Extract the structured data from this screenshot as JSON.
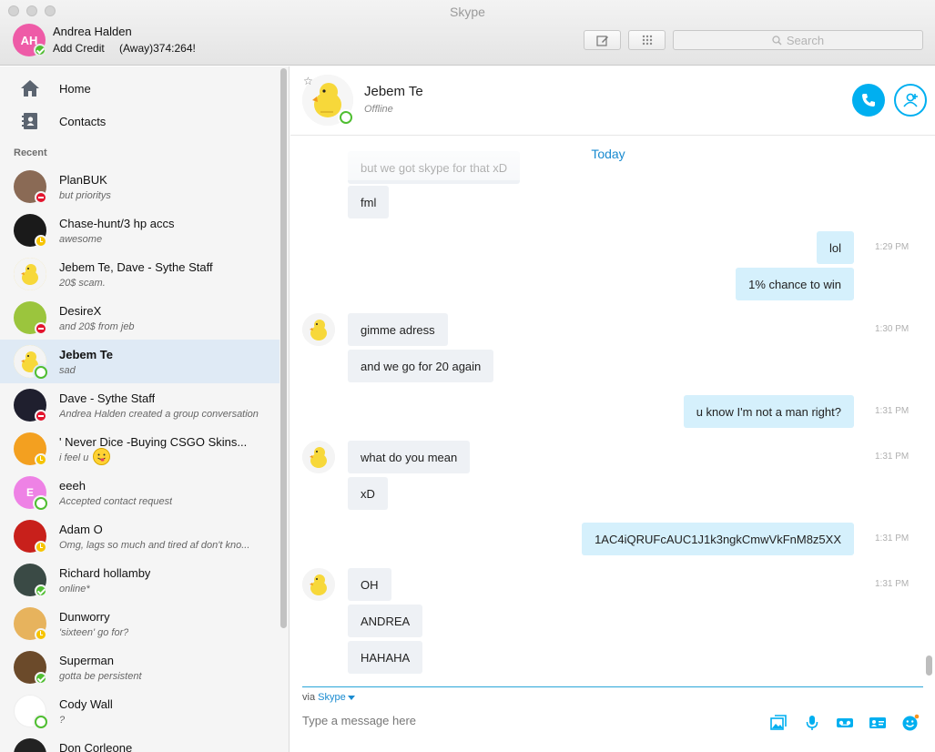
{
  "window": {
    "title": "Skype"
  },
  "profile": {
    "initials": "AH",
    "name": "Andrea Halden",
    "credit": "Add Credit",
    "mood": "(Away)374:264!"
  },
  "search": {
    "placeholder": "Search"
  },
  "nav": [
    {
      "label": "Home",
      "icon": "home-icon"
    },
    {
      "label": "Contacts",
      "icon": "contacts-icon"
    }
  ],
  "recent_label": "Recent",
  "contacts": [
    {
      "name": "PlanBUK",
      "mood": "but prioritys",
      "status": "dnd",
      "avatar_color": "#8a6a55"
    },
    {
      "name": "Chase-hunt/3 hp accs",
      "mood": "awesome",
      "status": "away",
      "avatar_color": "#1a1a1a"
    },
    {
      "name": "Jebem Te, Dave - Sythe Staff",
      "mood": "20$ scam.",
      "status": "none",
      "avatar_color": "#f1d24a"
    },
    {
      "name": "DesireX",
      "mood": "and 20$ from jeb",
      "status": "dnd",
      "avatar_color": "#9bc53d"
    },
    {
      "name": "Jebem Te",
      "mood": "sad",
      "status": "offline",
      "avatar_color": "#f1d24a",
      "active": true
    },
    {
      "name": "Dave - Sythe Staff",
      "mood": "Andrea Halden created a group conversation",
      "status": "dnd",
      "avatar_color": "#1f1f2e"
    },
    {
      "name": "' Never Dice -Buying CSGO Skins...",
      "mood": "i feel u",
      "status": "away",
      "avatar_color": "#f3a020"
    },
    {
      "name": "eeeh",
      "mood": "Accepted contact request",
      "status": "offline",
      "avatar_color": "#ee82e5",
      "initial": "E"
    },
    {
      "name": "Adam O",
      "mood": "Omg, lags so much and tired af don't kno...",
      "status": "away",
      "avatar_color": "#c8201b"
    },
    {
      "name": "Richard hollamby",
      "mood": "online*",
      "status": "online",
      "avatar_color": "#3a4a45"
    },
    {
      "name": "Dunworry",
      "mood": "'sixteen' go for?",
      "status": "away",
      "avatar_color": "#e7b35d"
    },
    {
      "name": "Superman",
      "mood": "gotta be persistent",
      "status": "online",
      "avatar_color": "#6b4a2a"
    },
    {
      "name": "Cody Wall",
      "mood": "?",
      "status": "offline",
      "avatar_color": "#ffffff"
    },
    {
      "name": "Don Corleone",
      "mood": "",
      "status": "none",
      "avatar_color": "#222222"
    }
  ],
  "conversation": {
    "name": "Jebem Te",
    "status": "Offline",
    "day": "Today",
    "messages": [
      {
        "dir": "in",
        "text": "but we got skype for that xD",
        "time": ""
      },
      {
        "dir": "in",
        "text": "fml",
        "time": ""
      },
      {
        "dir": "out",
        "text": "lol",
        "time": "1:29 PM"
      },
      {
        "dir": "out",
        "text": "1% chance to win",
        "time": ""
      },
      {
        "dir": "in",
        "text": "gimme adress",
        "time": "1:30 PM"
      },
      {
        "dir": "in",
        "text": "and we go for 20 again",
        "time": ""
      },
      {
        "dir": "out",
        "text": "u know I'm not a man right?",
        "time": "1:31 PM"
      },
      {
        "dir": "in",
        "text": "what do you mean",
        "time": "1:31 PM"
      },
      {
        "dir": "in",
        "text": "xD",
        "time": ""
      },
      {
        "dir": "out",
        "text": "1AC4iQRUFcAUC1J1k3ngkCmwVkFnM8z5XX",
        "time": "1:31 PM"
      },
      {
        "dir": "in",
        "text": "OH",
        "time": "1:31 PM"
      },
      {
        "dir": "in",
        "text": "ANDREA",
        "time": ""
      },
      {
        "dir": "in",
        "text": "HAHAHA",
        "time": ""
      }
    ]
  },
  "compose": {
    "via": "via",
    "service": "Skype",
    "placeholder": "Type a message here"
  },
  "colors": {
    "accent": "#00aff0",
    "outgoing": "#d5f0fc",
    "incoming": "#eef1f5"
  }
}
